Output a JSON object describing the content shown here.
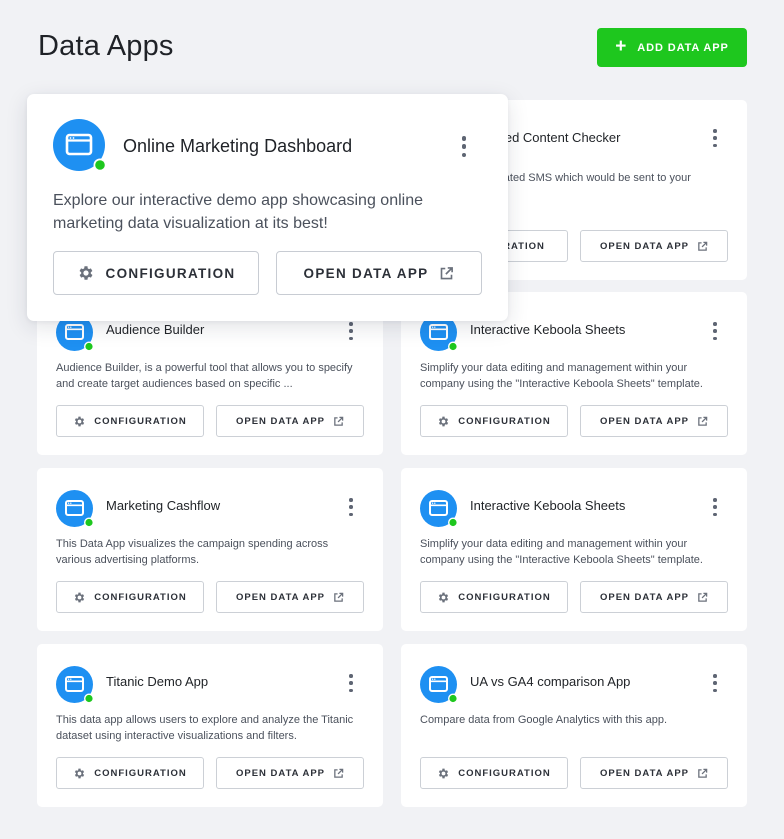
{
  "page": {
    "title": "Data Apps"
  },
  "toolbar": {
    "add_label": "ADD DATA APP",
    "add_icon": "plus-icon"
  },
  "colors": {
    "accent_green": "#1ec71e",
    "icon_blue": "#1e90f2",
    "status_green": "#1ec71e"
  },
  "featured": {
    "name": "Online Marketing Dashboard",
    "description": "Explore our interactive demo app showcasing online marketing data visualization at its best!",
    "config_label": "CONFIGURATION",
    "open_label": "OPEN DATA APP"
  },
  "partial": {
    "name": "ated Content Checker",
    "description": "erated SMS which would be sent to your",
    "config_label": "RATION",
    "open_label": "OPEN DATA APP"
  },
  "apps": [
    {
      "name": "Audience Builder",
      "description": "Audience Builder, is a powerful tool that allows you to specify and create target audiences based on specific ...",
      "config_label": "CONFIGURATION",
      "open_label": "OPEN DATA APP"
    },
    {
      "name": "Interactive Keboola Sheets",
      "description": "Simplify your data editing and management within your company using the \"Interactive Keboola Sheets\" template.",
      "config_label": "CONFIGURATION",
      "open_label": "OPEN DATA APP"
    },
    {
      "name": "Marketing Cashflow",
      "description": "This Data App visualizes the campaign spending across various advertising platforms.",
      "config_label": "CONFIGURATION",
      "open_label": "OPEN DATA APP"
    },
    {
      "name": "Interactive Keboola Sheets",
      "description": "Simplify your data editing and management within your company using the \"Interactive Keboola Sheets\" template.",
      "config_label": "CONFIGURATION",
      "open_label": "OPEN DATA APP"
    },
    {
      "name": "Titanic Demo App",
      "description": "This data app allows users to explore and analyze the Titanic dataset using interactive visualizations and filters.",
      "config_label": "CONFIGURATION",
      "open_label": "OPEN DATA APP"
    },
    {
      "name": "UA vs GA4 comparison App",
      "description": "Compare data from Google Analytics with this app.",
      "config_label": "CONFIGURATION",
      "open_label": "OPEN DATA APP"
    }
  ]
}
